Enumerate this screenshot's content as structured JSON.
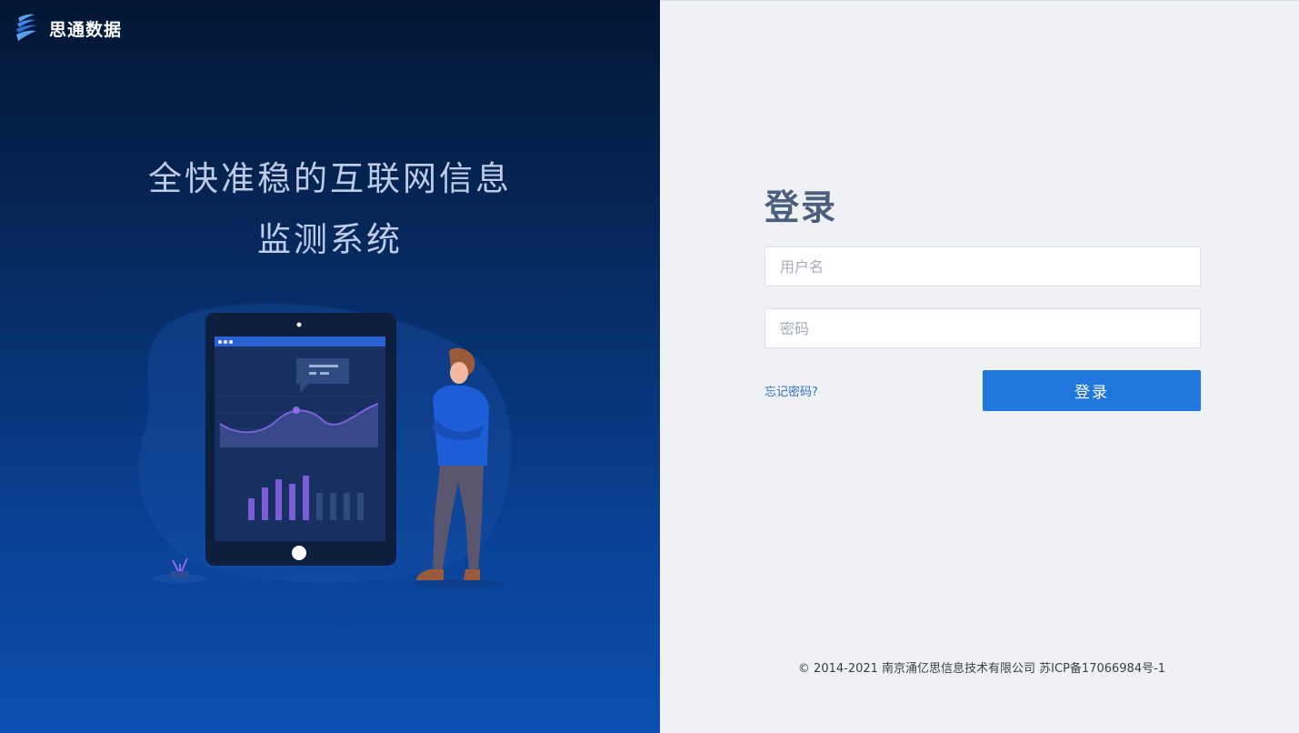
{
  "brand": {
    "name": "思通数据"
  },
  "hero": {
    "line1": "全快准稳的互联网信息",
    "line2": "监测系统"
  },
  "login": {
    "title": "登录",
    "username_placeholder": "用户名",
    "password_placeholder": "密码",
    "forgot_label": "忘记密码?",
    "submit_label": "登录"
  },
  "footer": {
    "text": "© 2014-2021 南京涌亿思信息技术有限公司 苏ICP备17066984号-1"
  },
  "colors": {
    "accent": "#2277dd",
    "title": "#4a5e7e",
    "right_bg": "#eff1f4",
    "left_top": "#021633",
    "left_bottom": "#0b4fb0"
  }
}
